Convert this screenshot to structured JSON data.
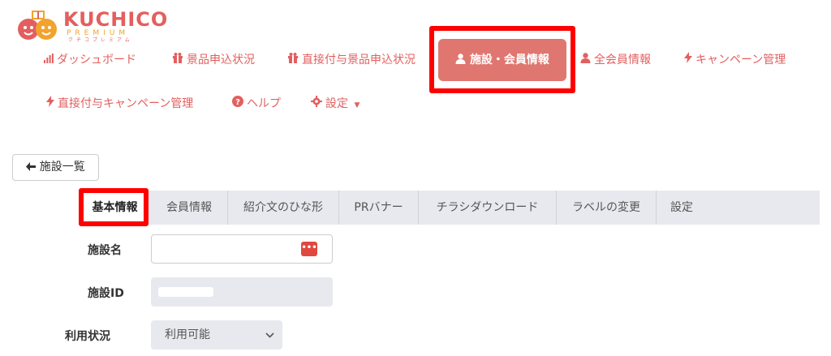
{
  "logo": {
    "brand": "KUCHICO",
    "sub": "PREMIUM",
    "kana": "クチコプレミアム"
  },
  "nav": {
    "dashboard": "ダッシュボード",
    "prize_status": "景品申込状況",
    "direct_prize_status": "直接付与景品申込状況",
    "facility_member": "施設・会員情報",
    "all_member": "全会員情報",
    "campaign": "キャンペーン管理",
    "direct_campaign": "直接付与キャンペーン管理",
    "help": "ヘルプ",
    "settings": "設定"
  },
  "back_button": "施設一覧",
  "tabs": [
    "基本情報",
    "会員情報",
    "紹介文のひな形",
    "PRバナー",
    "チラシダウンロード",
    "ラベルの変更",
    "設定"
  ],
  "form": {
    "facility_name_label": "施設名",
    "facility_name_value": "",
    "facility_id_label": "施設ID",
    "usage_label": "利用状況",
    "usage_value": "利用可能"
  },
  "colors": {
    "accent": "#e35f5f",
    "active_nav": "#e07670",
    "highlight": "#ff0000",
    "tab_bg": "#e7e9ee"
  }
}
